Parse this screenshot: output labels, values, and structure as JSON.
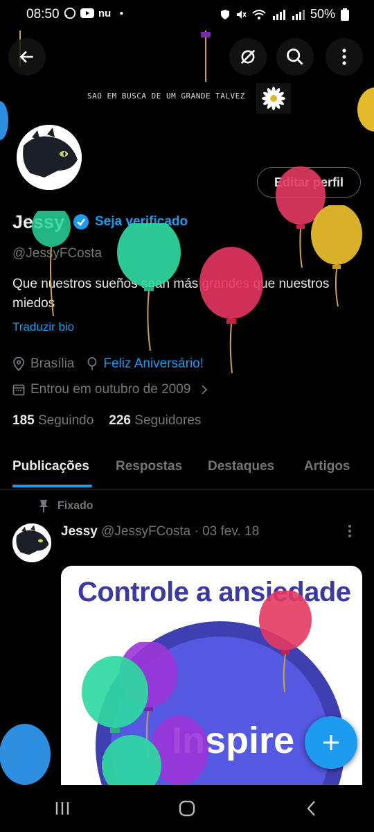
{
  "status_bar": {
    "time": "08:50",
    "left_icons": [
      "whatsapp-icon",
      "youtube-icon"
    ],
    "left_text": "nu",
    "right_text": "50%",
    "right_icons": [
      "shield-icon",
      "mute-icon",
      "wifi-icon",
      "signal-icon",
      "signal-icon",
      "battery-icon"
    ]
  },
  "banner": {
    "text": "SAO EM BUSCA DE UM GRANDE TALVEZ"
  },
  "header": {
    "back_icon": "arrow-left-icon",
    "hide_icon": "eye-slash-icon",
    "search_icon": "search-icon",
    "more_icon": "more-vertical-icon"
  },
  "profile": {
    "edit_label": "Editar perfil",
    "name": "Jessy",
    "verify_label": "Seja verificado",
    "handle": "@JessyFCosta",
    "bio": "Que nuestros sueños sean más grandes que nuestros miedos",
    "translate_label": "Traduzir bio",
    "location": "Brasília",
    "birthday": "Feliz Aniversário!",
    "joined": "Entrou em outubro de 2009",
    "following_count": "185",
    "following_label": "Seguindo",
    "followers_count": "226",
    "followers_label": "Seguidores"
  },
  "tabs": [
    {
      "label": "Publicações",
      "active": true
    },
    {
      "label": "Respostas",
      "active": false
    },
    {
      "label": "Destaques",
      "active": false
    },
    {
      "label": "Artigos",
      "active": false
    }
  ],
  "post": {
    "pinned_label": "Fixado",
    "author": "Jessy",
    "handle_date": "@JessyFCosta · 03 fev. 18",
    "media_title": "Controle a ansiedade",
    "media_word": "Inspire"
  },
  "colors": {
    "accent": "#1d9bf0",
    "background": "#000000",
    "muted": "#71767b"
  }
}
